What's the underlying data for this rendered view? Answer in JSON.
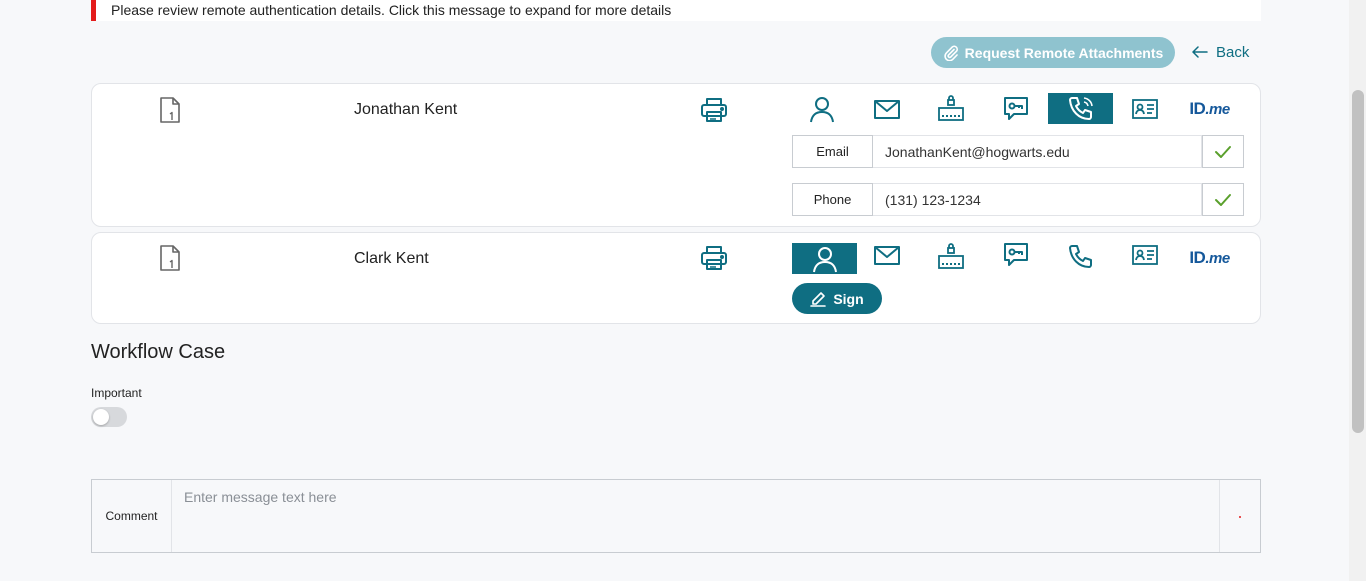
{
  "alert": {
    "text": "Please review remote authentication details. Click this message to expand for more details"
  },
  "toolbar": {
    "request_label": "Request Remote Attachments",
    "back_label": "Back"
  },
  "signers": [
    {
      "name": "Jonathan Kent",
      "active_method": "phone",
      "fields": [
        {
          "label": "Email",
          "value": "JonathanKent@hogwarts.edu"
        },
        {
          "label": "Phone",
          "value": "(131) 123-1234"
        }
      ]
    },
    {
      "name": "Clark Kent",
      "active_method": "person",
      "sign_label": "Sign"
    }
  ],
  "auth_methods": [
    "person-icon",
    "mail-icon",
    "keypad-icon",
    "chat-key-icon",
    "phone-icon",
    "id-card-icon",
    "idme-logo"
  ],
  "idme": {
    "id": "ID",
    "me": ".me"
  },
  "workflow": {
    "title": "Workflow Case",
    "important_label": "Important",
    "important_on": false
  },
  "comment": {
    "label": "Comment",
    "placeholder": "Enter message text here",
    "value": ""
  },
  "colors": {
    "accent": "#0f6e82",
    "accent_light": "#8fc3cf",
    "alert_red": "#e31b1b",
    "check_green": "#5aa02c",
    "idme_blue": "#15589b"
  }
}
